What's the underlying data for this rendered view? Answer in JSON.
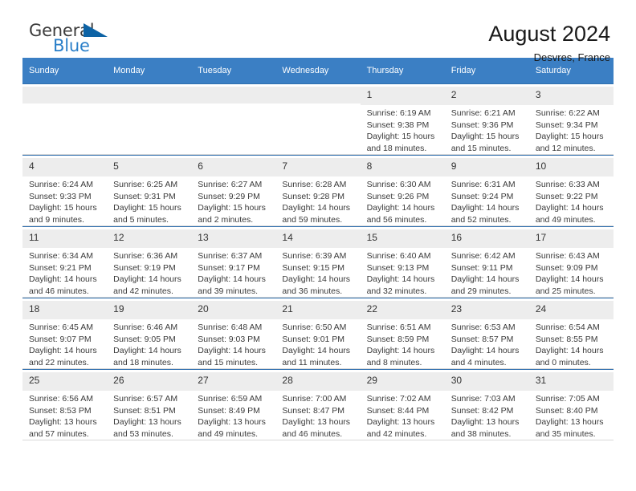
{
  "brand": {
    "name_part1": "General",
    "name_part2": "Blue",
    "triangle_color": "#0d63a5",
    "blue_color": "#2a7fc9"
  },
  "header": {
    "month_title": "August 2024",
    "location": "Desvres, France",
    "header_bg": "#3b7fc4"
  },
  "weekdays": [
    "Sunday",
    "Monday",
    "Tuesday",
    "Wednesday",
    "Thursday",
    "Friday",
    "Saturday"
  ],
  "weeks": [
    [
      {
        "day": "",
        "info": ""
      },
      {
        "day": "",
        "info": ""
      },
      {
        "day": "",
        "info": ""
      },
      {
        "day": "",
        "info": ""
      },
      {
        "day": "1",
        "info": "Sunrise: 6:19 AM\nSunset: 9:38 PM\nDaylight: 15 hours\nand 18 minutes."
      },
      {
        "day": "2",
        "info": "Sunrise: 6:21 AM\nSunset: 9:36 PM\nDaylight: 15 hours\nand 15 minutes."
      },
      {
        "day": "3",
        "info": "Sunrise: 6:22 AM\nSunset: 9:34 PM\nDaylight: 15 hours\nand 12 minutes."
      }
    ],
    [
      {
        "day": "4",
        "info": "Sunrise: 6:24 AM\nSunset: 9:33 PM\nDaylight: 15 hours\nand 9 minutes."
      },
      {
        "day": "5",
        "info": "Sunrise: 6:25 AM\nSunset: 9:31 PM\nDaylight: 15 hours\nand 5 minutes."
      },
      {
        "day": "6",
        "info": "Sunrise: 6:27 AM\nSunset: 9:29 PM\nDaylight: 15 hours\nand 2 minutes."
      },
      {
        "day": "7",
        "info": "Sunrise: 6:28 AM\nSunset: 9:28 PM\nDaylight: 14 hours\nand 59 minutes."
      },
      {
        "day": "8",
        "info": "Sunrise: 6:30 AM\nSunset: 9:26 PM\nDaylight: 14 hours\nand 56 minutes."
      },
      {
        "day": "9",
        "info": "Sunrise: 6:31 AM\nSunset: 9:24 PM\nDaylight: 14 hours\nand 52 minutes."
      },
      {
        "day": "10",
        "info": "Sunrise: 6:33 AM\nSunset: 9:22 PM\nDaylight: 14 hours\nand 49 minutes."
      }
    ],
    [
      {
        "day": "11",
        "info": "Sunrise: 6:34 AM\nSunset: 9:21 PM\nDaylight: 14 hours\nand 46 minutes."
      },
      {
        "day": "12",
        "info": "Sunrise: 6:36 AM\nSunset: 9:19 PM\nDaylight: 14 hours\nand 42 minutes."
      },
      {
        "day": "13",
        "info": "Sunrise: 6:37 AM\nSunset: 9:17 PM\nDaylight: 14 hours\nand 39 minutes."
      },
      {
        "day": "14",
        "info": "Sunrise: 6:39 AM\nSunset: 9:15 PM\nDaylight: 14 hours\nand 36 minutes."
      },
      {
        "day": "15",
        "info": "Sunrise: 6:40 AM\nSunset: 9:13 PM\nDaylight: 14 hours\nand 32 minutes."
      },
      {
        "day": "16",
        "info": "Sunrise: 6:42 AM\nSunset: 9:11 PM\nDaylight: 14 hours\nand 29 minutes."
      },
      {
        "day": "17",
        "info": "Sunrise: 6:43 AM\nSunset: 9:09 PM\nDaylight: 14 hours\nand 25 minutes."
      }
    ],
    [
      {
        "day": "18",
        "info": "Sunrise: 6:45 AM\nSunset: 9:07 PM\nDaylight: 14 hours\nand 22 minutes."
      },
      {
        "day": "19",
        "info": "Sunrise: 6:46 AM\nSunset: 9:05 PM\nDaylight: 14 hours\nand 18 minutes."
      },
      {
        "day": "20",
        "info": "Sunrise: 6:48 AM\nSunset: 9:03 PM\nDaylight: 14 hours\nand 15 minutes."
      },
      {
        "day": "21",
        "info": "Sunrise: 6:50 AM\nSunset: 9:01 PM\nDaylight: 14 hours\nand 11 minutes."
      },
      {
        "day": "22",
        "info": "Sunrise: 6:51 AM\nSunset: 8:59 PM\nDaylight: 14 hours\nand 8 minutes."
      },
      {
        "day": "23",
        "info": "Sunrise: 6:53 AM\nSunset: 8:57 PM\nDaylight: 14 hours\nand 4 minutes."
      },
      {
        "day": "24",
        "info": "Sunrise: 6:54 AM\nSunset: 8:55 PM\nDaylight: 14 hours\nand 0 minutes."
      }
    ],
    [
      {
        "day": "25",
        "info": "Sunrise: 6:56 AM\nSunset: 8:53 PM\nDaylight: 13 hours\nand 57 minutes."
      },
      {
        "day": "26",
        "info": "Sunrise: 6:57 AM\nSunset: 8:51 PM\nDaylight: 13 hours\nand 53 minutes."
      },
      {
        "day": "27",
        "info": "Sunrise: 6:59 AM\nSunset: 8:49 PM\nDaylight: 13 hours\nand 49 minutes."
      },
      {
        "day": "28",
        "info": "Sunrise: 7:00 AM\nSunset: 8:47 PM\nDaylight: 13 hours\nand 46 minutes."
      },
      {
        "day": "29",
        "info": "Sunrise: 7:02 AM\nSunset: 8:44 PM\nDaylight: 13 hours\nand 42 minutes."
      },
      {
        "day": "30",
        "info": "Sunrise: 7:03 AM\nSunset: 8:42 PM\nDaylight: 13 hours\nand 38 minutes."
      },
      {
        "day": "31",
        "info": "Sunrise: 7:05 AM\nSunset: 8:40 PM\nDaylight: 13 hours\nand 35 minutes."
      }
    ]
  ]
}
